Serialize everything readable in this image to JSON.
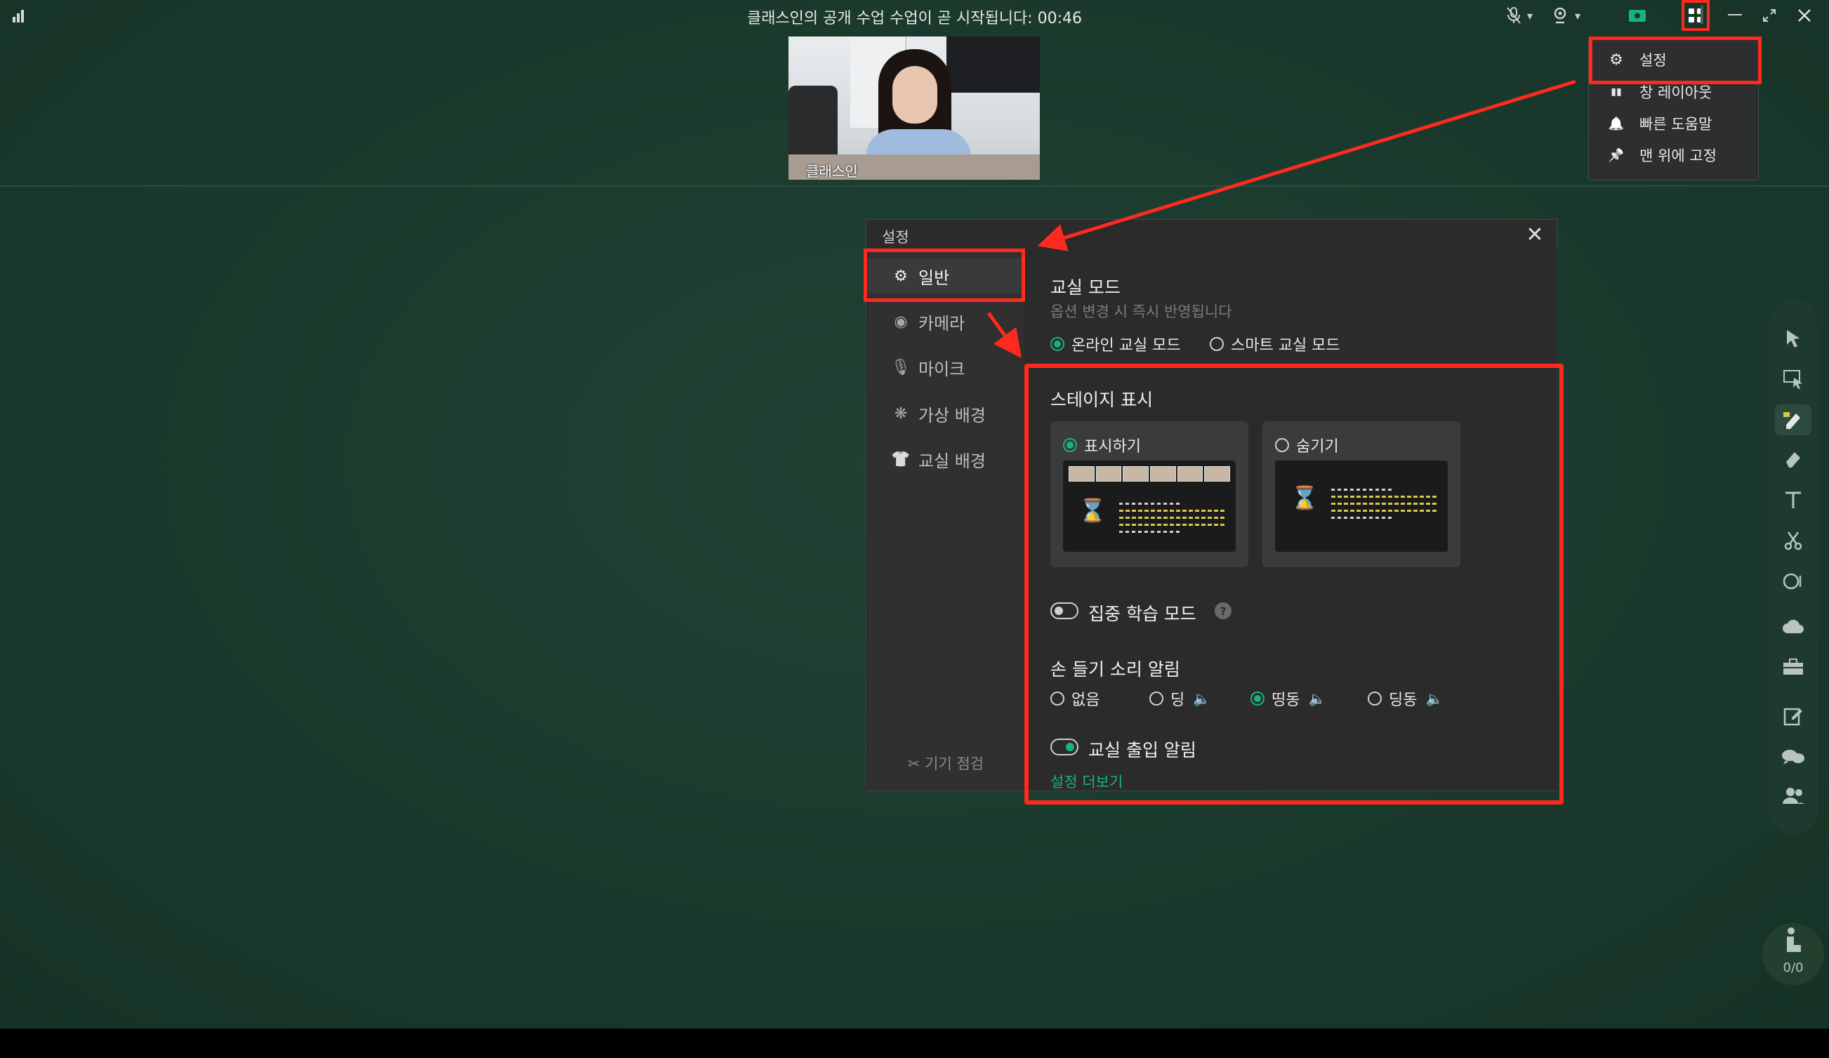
{
  "topbar": {
    "title": "클래스인의 공개 수업   수업이 곧 시작됩니다: 00:46",
    "icons": [
      "signal-icon",
      "mic-muted-icon",
      "camera-icon",
      "screen-share-icon",
      "apps-grid-icon",
      "minimize-icon",
      "restore-icon",
      "close-icon"
    ],
    "caret": "▾"
  },
  "camera": {
    "name": "클래스인"
  },
  "menu": {
    "items": [
      {
        "icon": "gear-icon",
        "glyph": "⚙",
        "label": "설정"
      },
      {
        "icon": "layout-icon",
        "glyph": "▮▮",
        "label": "창 레이아웃"
      },
      {
        "icon": "bell-icon",
        "glyph": "🔔",
        "label": "빠른 도움말"
      },
      {
        "icon": "pin-icon",
        "glyph": "📌",
        "label": "맨 위에 고정"
      }
    ]
  },
  "dialog": {
    "title": "설정",
    "close": "✕",
    "sidebar": [
      {
        "icon": "gear-icon",
        "glyph": "⚙",
        "label": "일반"
      },
      {
        "icon": "camera-icon",
        "glyph": "◉",
        "label": "카메라"
      },
      {
        "icon": "mic-icon",
        "glyph": "🎙",
        "label": "마이크"
      },
      {
        "icon": "virtual-bg-icon",
        "glyph": "❋",
        "label": "가상 배경"
      },
      {
        "icon": "shirt-icon",
        "glyph": "👕",
        "label": "교실 배경"
      }
    ],
    "device_check": "기기 점검",
    "classroom_mode": {
      "title": "교실 모드",
      "subtitle": "옵션 변경 시 즉시 반영됩니다",
      "options": [
        "온라인 교실 모드",
        "스마트 교실 모드"
      ],
      "selected": "온라인 교실 모드"
    },
    "stage": {
      "title": "스테이지 표시",
      "show": "표시하기",
      "hide": "숨기기",
      "selected": "표시하기"
    },
    "focus_mode": {
      "label": "집중 학습 모드",
      "help": "?",
      "enabled": false
    },
    "hand_raise": {
      "title": "손 들기 소리 알림",
      "options": [
        "없음",
        "딩",
        "띵동",
        "딩동"
      ],
      "selected": "띵동"
    },
    "entry_alert": {
      "label": "교실 출입 알림",
      "enabled": true
    },
    "more": "설정 더보기"
  },
  "toolbar": {
    "tools": [
      "select-icon",
      "region-select-icon",
      "pen-icon",
      "eraser-icon",
      "text-icon",
      "scissors-icon",
      "shape-icon",
      "cloud-icon",
      "toolbox-icon",
      "edit-icon",
      "chat-icon",
      "users-icon"
    ],
    "seat_count": "0/0"
  },
  "colors": {
    "accent": "#19b27e",
    "highlight": "#ff2a1f",
    "board": "#1b3a2e"
  }
}
